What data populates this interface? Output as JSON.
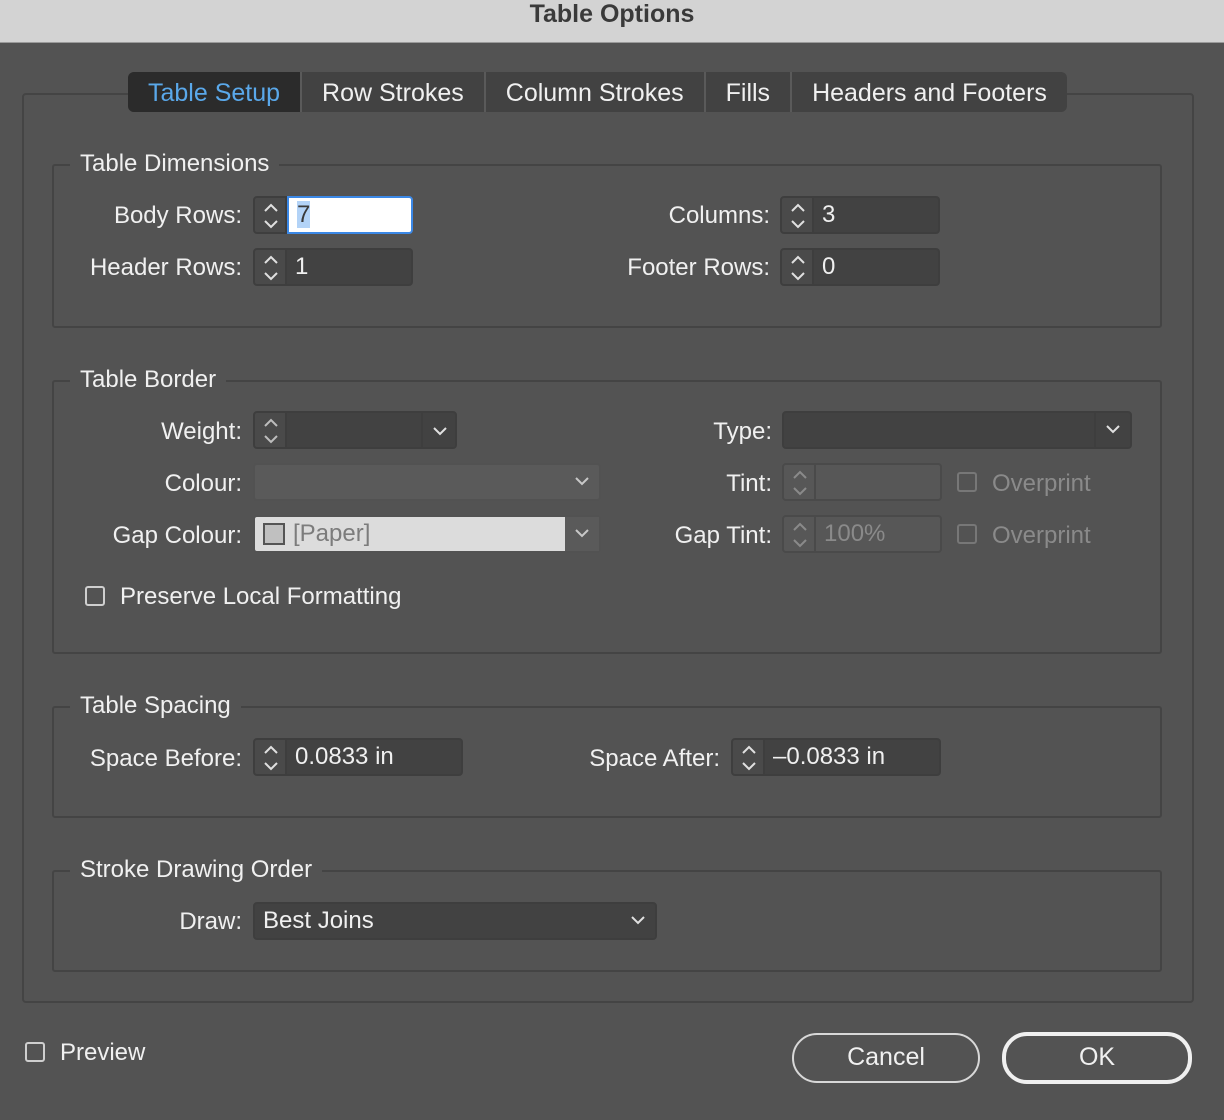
{
  "window": {
    "title": "Table Options"
  },
  "tabs": [
    {
      "label": "Table Setup",
      "active": true
    },
    {
      "label": "Row Strokes"
    },
    {
      "label": "Column Strokes"
    },
    {
      "label": "Fills"
    },
    {
      "label": "Headers and Footers"
    }
  ],
  "dimensions": {
    "legend": "Table Dimensions",
    "body_rows_label": "Body Rows:",
    "body_rows": "7",
    "columns_label": "Columns:",
    "columns": "3",
    "header_rows_label": "Header Rows:",
    "header_rows": "1",
    "footer_rows_label": "Footer Rows:",
    "footer_rows": "0"
  },
  "border": {
    "legend": "Table Border",
    "weight_label": "Weight:",
    "weight": "",
    "type_label": "Type:",
    "type": "",
    "colour_label": "Colour:",
    "colour": "",
    "tint_label": "Tint:",
    "tint": "",
    "overprint1": "Overprint",
    "gap_colour_label": "Gap Colour:",
    "gap_colour": "[Paper]",
    "gap_tint_label": "Gap Tint:",
    "gap_tint": "100%",
    "overprint2": "Overprint",
    "preserve": "Preserve Local Formatting"
  },
  "spacing": {
    "legend": "Table Spacing",
    "before_label": "Space Before:",
    "before": "0.0833 in",
    "after_label": "Space After:",
    "after": "–0.0833 in"
  },
  "stroke_order": {
    "legend": "Stroke Drawing Order",
    "draw_label": "Draw:",
    "draw": "Best Joins"
  },
  "footer": {
    "preview": "Preview",
    "cancel": "Cancel",
    "ok": "OK"
  }
}
